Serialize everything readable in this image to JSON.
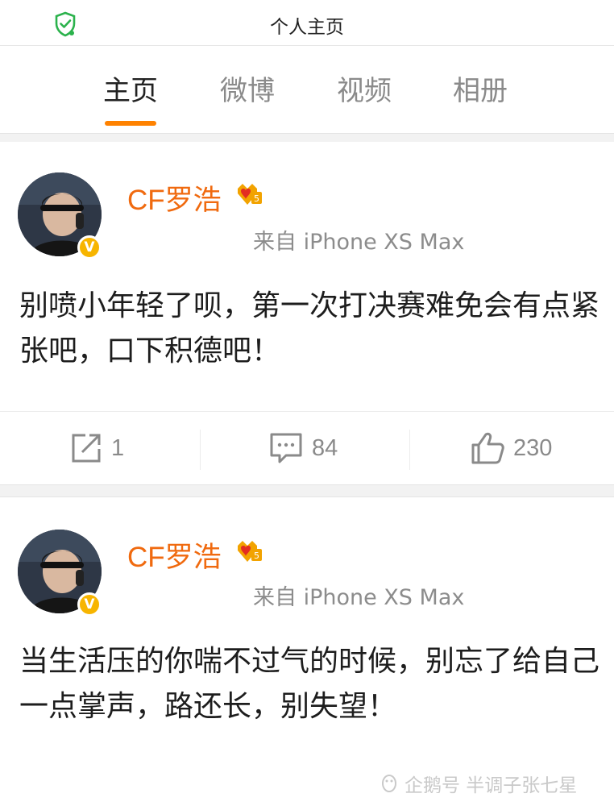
{
  "header": {
    "title": "个人主页",
    "shield_icon": "shield-check-icon"
  },
  "tabs": [
    {
      "label": "主页",
      "active": true
    },
    {
      "label": "微博",
      "active": false
    },
    {
      "label": "视频",
      "active": false
    },
    {
      "label": "相册",
      "active": false
    }
  ],
  "colors": {
    "accent": "#ff8200",
    "username": "#f06a0f",
    "verified": "#f7b500"
  },
  "posts": [
    {
      "username": "CF罗浩",
      "source": "来自 iPhone XS Max",
      "text": "别喷小年轻了呗，第一次打决赛难免会有点紧张吧，口下积德吧！",
      "repost_count": "1",
      "comment_count": "84",
      "like_count": "230"
    },
    {
      "username": "CF罗浩",
      "source": "来自 iPhone XS Max",
      "text": "当生活压的你喘不过气的时候，别忘了给自己一点掌声，路还长，别失望！"
    }
  ],
  "watermark": {
    "text": "企鹅号 半调子张七星"
  }
}
